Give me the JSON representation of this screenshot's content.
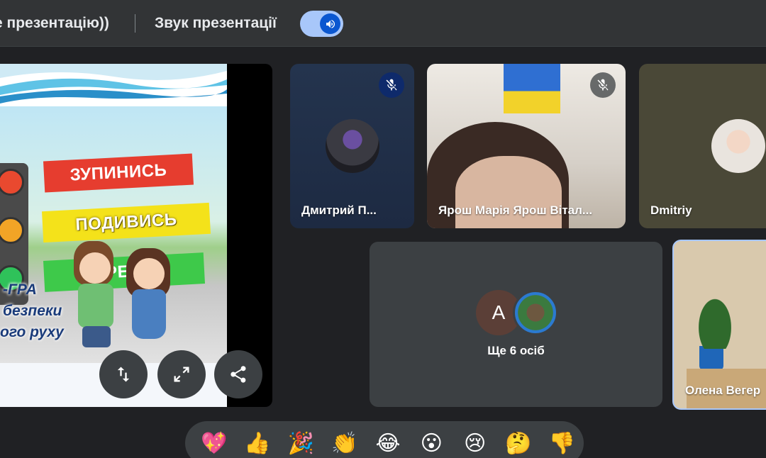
{
  "topbar": {
    "presentation_label": "е презентацію))",
    "sound_label": "Звук презентації",
    "sound_toggle_on": true
  },
  "slide": {
    "banners": [
      "ЗУПИНИСЬ",
      "ПОДИВИСЬ",
      "ПЕРЕЙДИ"
    ],
    "text_lines": [
      "-ГРА",
      "безпеки",
      "ого руху"
    ]
  },
  "participants": [
    {
      "name": "Дмитрий П...",
      "muted": true
    },
    {
      "name": "Ярош Марія Ярош Вітал...",
      "muted": true
    },
    {
      "name": "Dmitriy",
      "muted": false
    },
    {
      "name": "Олена Вегер",
      "muted": false
    }
  ],
  "others": {
    "avatar_letter": "А",
    "label": "Ще 6 осіб"
  },
  "reactions": [
    "💖",
    "👍",
    "🎉",
    "👏",
    "😂",
    "😮",
    "😢",
    "🤔",
    "👎"
  ],
  "colors": {
    "accent": "#a8c7fa",
    "toggle_knob": "#0b57d0",
    "background": "#202124",
    "tile": "#3c4043"
  }
}
